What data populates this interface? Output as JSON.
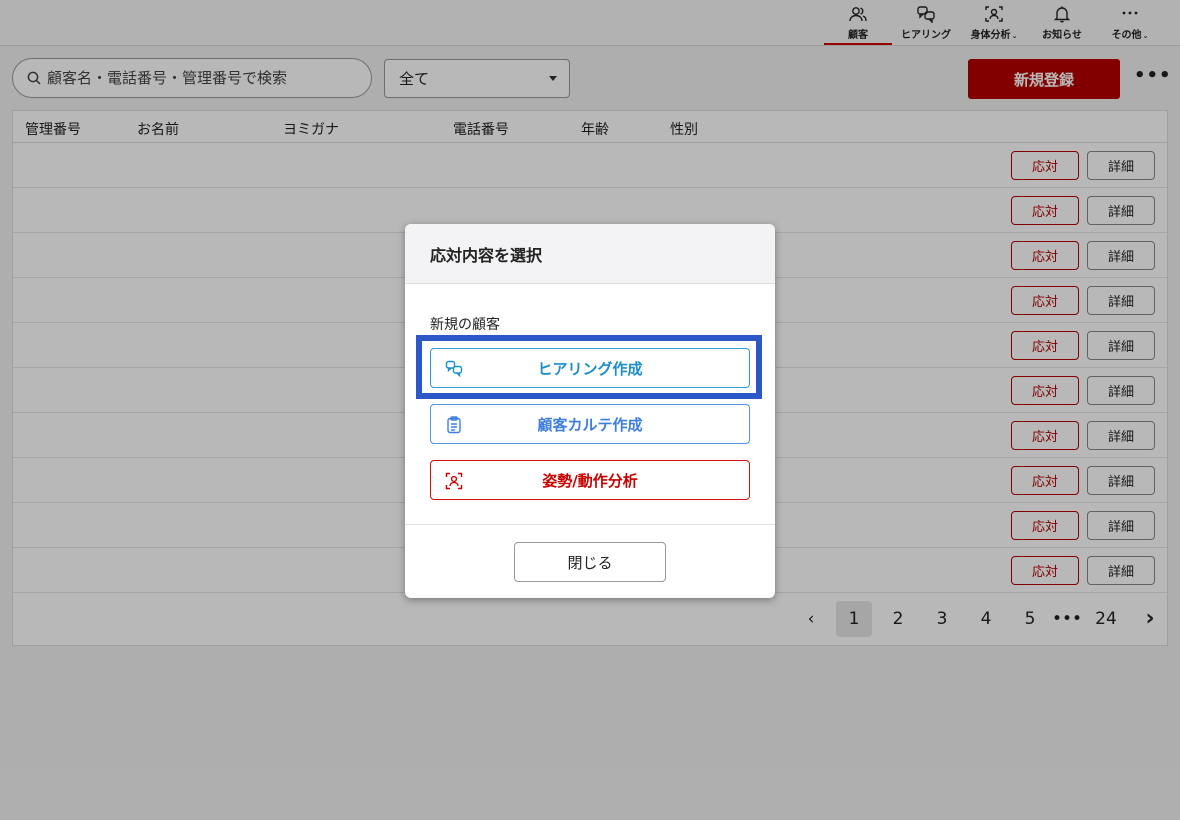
{
  "nav": {
    "items": [
      {
        "label": "顧客",
        "icon": "users-icon",
        "active": true
      },
      {
        "label": "ヒアリング",
        "icon": "chat-bubbles-icon",
        "active": false
      },
      {
        "label": "身体分析",
        "icon": "face-scan-icon",
        "active": false,
        "has_caret": true
      },
      {
        "label": "お知らせ",
        "icon": "bell-icon",
        "active": false
      },
      {
        "label": "その他",
        "icon": "more-dots-icon",
        "active": false,
        "has_caret": true
      }
    ],
    "caret": "⌄"
  },
  "toolbar": {
    "search_placeholder": "顧客名・電話番号・管理番号で検索",
    "filter_value": "全て",
    "register_label": "新規登録",
    "more_label": "•••"
  },
  "table": {
    "columns": [
      "管理番号",
      "お名前",
      "ヨミガナ",
      "電話番号",
      "年齢",
      "性別"
    ],
    "row_count": 10,
    "respond_label": "応対",
    "detail_label": "詳細"
  },
  "pagination": {
    "prev": "‹",
    "pages": [
      "1",
      "2",
      "3",
      "4",
      "5"
    ],
    "ellipsis": "•••",
    "last": "24",
    "next": "›",
    "current": "1"
  },
  "modal": {
    "title": "応対内容を選択",
    "section_label": "新規の顧客",
    "options": [
      {
        "label": "ヒアリング作成",
        "icon": "chat-bubbles-icon",
        "color": "#1a8fcc"
      },
      {
        "label": "顧客カルテ作成",
        "icon": "clipboard-icon",
        "color": "#3d7ee0"
      },
      {
        "label": "姿勢/動作分析",
        "icon": "face-scan-icon",
        "color": "#c80000"
      }
    ],
    "close_label": "閉じる"
  },
  "colors": {
    "brand": "#b40000",
    "highlight": "#2b57c9"
  }
}
